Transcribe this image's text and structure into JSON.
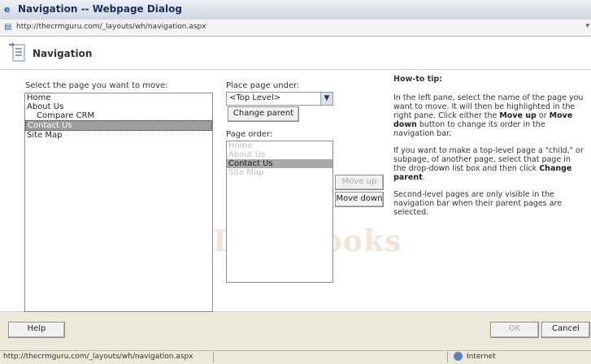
{
  "window": {
    "title": "Navigation -- Webpage Dialog",
    "url": "http://thecrmguru.com/_layouts/wh/navigation.aspx"
  },
  "header": {
    "title": "Navigation"
  },
  "left_pane": {
    "label": "Select the page you want to move:",
    "items": [
      {
        "label": "Home",
        "indent": false,
        "selected": false
      },
      {
        "label": "About Us",
        "indent": false,
        "selected": false
      },
      {
        "label": "Compare CRM",
        "indent": true,
        "selected": false
      },
      {
        "label": "Contact Us",
        "indent": false,
        "selected": true
      },
      {
        "label": "Site Map",
        "indent": false,
        "selected": false
      }
    ]
  },
  "parent_select": {
    "label": "Place page under:",
    "value": "<Top Level>",
    "change_button": "Change parent"
  },
  "page_order": {
    "label": "Page order:",
    "items": [
      {
        "label": "Home",
        "dim": true,
        "selected": false
      },
      {
        "label": "About Us",
        "dim": true,
        "selected": false
      },
      {
        "label": "Contact Us",
        "dim": false,
        "selected": true
      },
      {
        "label": "Site Map",
        "dim": true,
        "selected": false
      }
    ],
    "move_up": "Move up",
    "move_down": "Move down"
  },
  "tip": {
    "title": "How-to tip:",
    "p1_a": "In the left pane, select the name of the page you want to move. It will then be highlighted in the right pane. Click either the ",
    "p1_b": "Move up",
    "p1_c": " or ",
    "p1_d": "Move down",
    "p1_e": " button to change its order in the navigation bar.",
    "p2_a": "If you want to make a top-level page a \"child,\" or subpage, of another page, select that page in the drop-down list box and then click ",
    "p2_b": "Change parent",
    "p2_c": ".",
    "p3": "Second-level pages are only visible in the navigation bar when their parent pages are selected."
  },
  "watermark": "DropBooks",
  "footer": {
    "help": "Help",
    "ok": "OK",
    "cancel": "Cancel"
  },
  "status": {
    "url": "http://thecrmguru.com/_layouts/wh/navigation.aspx",
    "zone": "Internet"
  }
}
